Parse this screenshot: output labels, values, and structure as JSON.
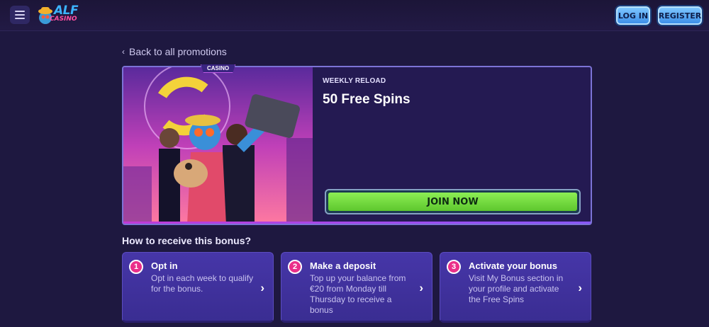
{
  "header": {
    "logo_top": "ALF",
    "logo_bottom": "CASINO",
    "login_label": "LOG IN",
    "register_label": "REGISTER"
  },
  "nav": {
    "back_label": "Back to all promotions"
  },
  "promo": {
    "tag": "CASINO",
    "eyebrow": "WEEKLY RELOAD",
    "title": "50 Free Spins",
    "cta_label": "JOIN NOW"
  },
  "steps": {
    "heading": "How to receive this bonus?",
    "items": [
      {
        "number": "1",
        "title": "Opt in",
        "description": "Opt in each week to qualify for the bonus."
      },
      {
        "number": "2",
        "title": "Make a deposit",
        "description": "Top up your balance from €20 from Monday till Thursday to receive a bonus"
      },
      {
        "number": "3",
        "title": "Activate your bonus",
        "description": "Visit My Bonus section in your profile and activate the Free Spins"
      }
    ]
  },
  "colors": {
    "background": "#1e1840",
    "accent_green": "#6ed63b",
    "accent_pink": "#ea2f8a",
    "card_purple": "#4636a8",
    "button_blue": "#5aa8f4"
  }
}
